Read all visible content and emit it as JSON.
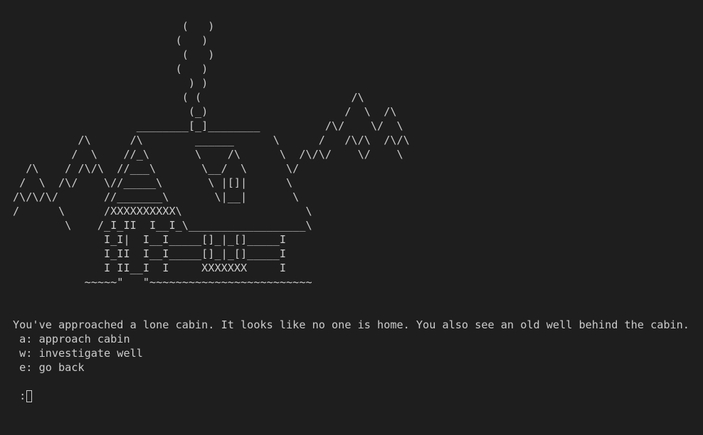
{
  "scene": {
    "ascii_art": "                          (   )\n                         (   )\n                          (   )\n                         (   )\n                           ) )\n                          ( (                       /\\\n                           (_)                     /  \\  /\\\n                   ________[_]________          /\\/    \\/  \\\n          /\\      /\\        ______      \\      /   /\\/\\  /\\/\\\n         /  \\    //_\\       \\    /\\      \\  /\\/\\/    \\/    \\\n  /\\    / /\\/\\  //___\\       \\__/  \\      \\/\n /  \\  /\\/    \\//_____\\       \\ |[]|      \\\n/\\/\\/\\/       //_______\\       \\|__|       \\\n/      \\      /XXXXXXXXXX\\                   \\\n        \\    /_I_II  I__I_\\__________________\\\n              I_I|  I__I_____[]_|_[]_____I\n              I_II  I__I_____[]_|_[]_____I\n              I II__I  I     XXXXXXX     I\n           ~~~~~\"   \"~~~~~~~~~~~~~~~~~~~~~~~~~"
  },
  "narration": "You've approached a lone cabin. It looks like no one is home. You also see an old well behind the cabin.",
  "options": [
    {
      "text": " a: approach cabin"
    },
    {
      "text": " w: investigate well"
    },
    {
      "text": " e: go back"
    }
  ],
  "prompt": {
    "symbol": " :"
  }
}
